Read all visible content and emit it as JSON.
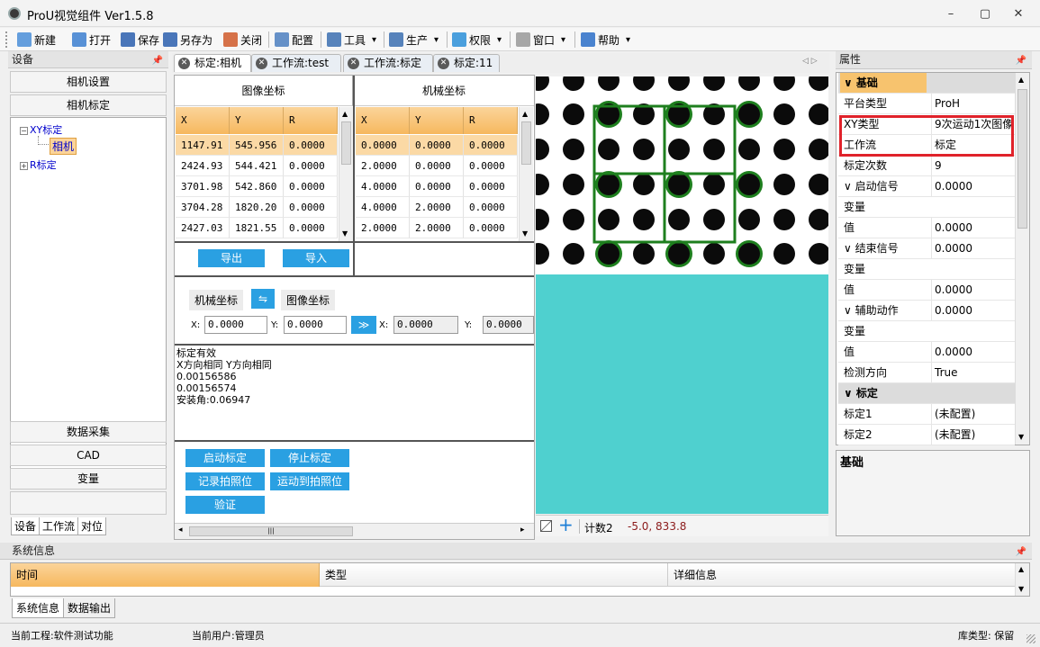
{
  "window": {
    "title": "ProU视觉组件 Ver1.5.8",
    "min": "–",
    "max": "▢",
    "close": "✕"
  },
  "toolbar": {
    "items": [
      {
        "label": "新建",
        "icon": "new-file-icon",
        "color": "#4a8ed8"
      },
      {
        "label": "打开",
        "icon": "open-folder-icon",
        "color": "#3c7fd0"
      },
      {
        "label": "保存",
        "icon": "save-icon",
        "color": "#2b5fae"
      },
      {
        "label": "另存为",
        "icon": "save-as-icon",
        "color": "#2b5fae"
      },
      {
        "label": "关闭",
        "icon": "close-doc-icon",
        "color": "#d05a2a"
      },
      {
        "label": "配置",
        "icon": "gear-icon",
        "color": "#4c7fbf"
      },
      {
        "label": "工具",
        "icon": "tools-icon",
        "color": "#3b6fb0"
      },
      {
        "label": "生产",
        "icon": "edit-icon",
        "color": "#3b6fb0"
      },
      {
        "label": "权限",
        "icon": "user-icon",
        "color": "#2c8fd8"
      },
      {
        "label": "窗口",
        "icon": "window-icon",
        "color": "#999999"
      },
      {
        "label": "帮助",
        "icon": "help-icon",
        "color": "#2c6fc8"
      }
    ]
  },
  "left": {
    "title": "设备",
    "buttons": [
      "相机设置",
      "相机标定"
    ],
    "tree": {
      "root1": "XY标定",
      "child": "相机",
      "root2": "R标定"
    },
    "lower": [
      "数据采集",
      "CAD",
      "变量"
    ],
    "tabs": [
      "设备",
      "工作流",
      "对位"
    ]
  },
  "doc_tabs": [
    "标定:相机",
    "工作流:test",
    "工作流:标定",
    "标定:11"
  ],
  "image_grid": {
    "title": "图像坐标",
    "cols": [
      "X",
      "Y",
      "R"
    ],
    "rows": [
      [
        "1147.91",
        "545.956",
        "0.0000"
      ],
      [
        "2424.93",
        "544.421",
        "0.0000"
      ],
      [
        "3701.98",
        "542.860",
        "0.0000"
      ],
      [
        "3704.28",
        "1820.20",
        "0.0000"
      ],
      [
        "2427.03",
        "1821.55",
        "0.0000"
      ]
    ]
  },
  "machine_grid": {
    "title": "机械坐标",
    "cols": [
      "X",
      "Y",
      "R"
    ],
    "rows": [
      [
        "0.0000",
        "0.0000",
        "0.0000"
      ],
      [
        "2.0000",
        "0.0000",
        "0.0000"
      ],
      [
        "4.0000",
        "0.0000",
        "0.0000"
      ],
      [
        "4.0000",
        "2.0000",
        "0.0000"
      ],
      [
        "2.0000",
        "2.0000",
        "0.0000"
      ]
    ]
  },
  "grid_buttons": {
    "export": "导出",
    "import": "导入"
  },
  "convert": {
    "left_label": "机械坐标",
    "swap": "⇋",
    "right_label": "图像坐标",
    "xl": "X:",
    "yl": "Y:",
    "x_in": "0.0000",
    "y_in": "0.0000",
    "go": "≫",
    "x_out": "0.0000",
    "y_out": "0.0000"
  },
  "result": {
    "lines": [
      "标定有效",
      "X方向相同 Y方向相同",
      "0.00156586",
      "0.00156574",
      "安装角:0.06947"
    ]
  },
  "actions": {
    "start": "启动标定",
    "stop": "停止标定",
    "record": "记录拍照位",
    "move": "运动到拍照位",
    "verify": "验证"
  },
  "canvas_status": {
    "count": "计数2",
    "coord": "-5.0, 833.8"
  },
  "props": {
    "title": "属性",
    "rows": [
      {
        "k": "∨ 基础",
        "v": "",
        "cat": true
      },
      {
        "k": "平台类型",
        "v": "ProH"
      },
      {
        "k": "XY类型",
        "v": "9次运动1次图像"
      },
      {
        "k": "工作流",
        "v": "标定"
      },
      {
        "k": "标定次数",
        "v": "9"
      },
      {
        "k": "∨ 启动信号",
        "v": "0.0000"
      },
      {
        "k": "变量",
        "v": ""
      },
      {
        "k": "值",
        "v": "0.0000"
      },
      {
        "k": "∨ 结束信号",
        "v": "0.0000"
      },
      {
        "k": "变量",
        "v": ""
      },
      {
        "k": "值",
        "v": "0.0000"
      },
      {
        "k": "∨ 辅助动作",
        "v": "0.0000"
      },
      {
        "k": "变量",
        "v": ""
      },
      {
        "k": "值",
        "v": "0.0000"
      },
      {
        "k": "检测方向",
        "v": "True"
      },
      {
        "k": "∨ 标定",
        "v": "",
        "cat": true
      },
      {
        "k": "标定1",
        "v": "(未配置)"
      },
      {
        "k": "标定2",
        "v": "(未配置)"
      }
    ],
    "desc": "基础"
  },
  "sysinfo": {
    "title": "系统信息",
    "cols": [
      "时间",
      "类型",
      "详细信息"
    ],
    "tabs": [
      "系统信息",
      "数据输出"
    ]
  },
  "status": {
    "project": "当前工程:软件测试功能",
    "user": "当前用户:管理员",
    "db": "库类型: 保留"
  }
}
